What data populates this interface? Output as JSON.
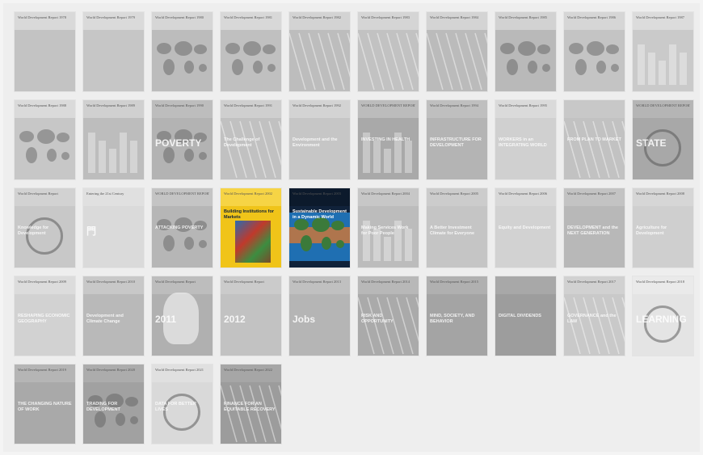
{
  "palette": {
    "page_bg": "#f4f4f4",
    "grid_bg": "#eeeeee",
    "muted_cover": "#c9c9c9",
    "accent_yellow": "#f0c419",
    "accent_dark": "#10223a"
  },
  "covers": [
    {
      "title": "World Development Report 1978",
      "big": "",
      "bg": "#c3c3c3",
      "top": "#d9d9d9",
      "style": "plain"
    },
    {
      "title": "World Development Report 1979",
      "big": "",
      "bg": "#c6c6c6",
      "top": "#dadada",
      "style": "plain"
    },
    {
      "title": "World Development Report 1980",
      "big": "",
      "bg": "#bcbcbc",
      "top": "#d6d6d6",
      "style": "map"
    },
    {
      "title": "World Development Report 1981",
      "big": "",
      "bg": "#c0c0c0",
      "top": "#d8d8d8",
      "style": "map"
    },
    {
      "title": "World Development Report 1982",
      "big": "",
      "bg": "#bdbdbd",
      "top": "#d3d3d3",
      "style": "lines"
    },
    {
      "title": "World Development Report 1983",
      "big": "",
      "bg": "#c2c2c2",
      "top": "#d5d5d5",
      "style": "lines"
    },
    {
      "title": "World Development Report 1984",
      "big": "",
      "bg": "#bbbbbb",
      "top": "#d4d4d4",
      "style": "lines"
    },
    {
      "title": "World Development Report 1985",
      "big": "",
      "bg": "#b9b9b9",
      "top": "#d2d2d2",
      "style": "map"
    },
    {
      "title": "World Development Report 1986",
      "big": "",
      "bg": "#c4c4c4",
      "top": "#d6d6d6",
      "style": "map"
    },
    {
      "title": "World Development Report 1987",
      "big": "",
      "bg": "#cacaca",
      "top": "#dcdcdc",
      "style": "bars"
    },
    {
      "title": "World Development Report 1988",
      "big": "",
      "bg": "#c7c7c7",
      "top": "#dadada",
      "style": "map"
    },
    {
      "title": "World Development Report 1989",
      "big": "",
      "bg": "#bdbdbd",
      "top": "#d0d0d0",
      "style": "bars"
    },
    {
      "title": "World Development Report 1990",
      "big": "POVERTY",
      "bg": "#b3b3b3",
      "top": "#bdbdbd",
      "style": "map"
    },
    {
      "title": "World Development Report 1991",
      "big": "The Challenge of Development",
      "bg": "#c1c1c1",
      "top": "#cfcfcf",
      "style": "lines"
    },
    {
      "title": "World Development Report 1992",
      "big": "Development and the Environment",
      "bg": "#c6c6c6",
      "top": "#d3d3d3",
      "style": "plain"
    },
    {
      "title": "WORLD DEVELOPMENT REPORT 1993",
      "big": "INVESTING IN HEALTH",
      "bg": "#a9a9a9",
      "top": "#bcbcbc",
      "style": "bars"
    },
    {
      "title": "World Development Report 1994",
      "big": "INFRASTRUCTURE FOR DEVELOPMENT",
      "bg": "#b4b4b4",
      "top": "#bfbfbf",
      "style": "plain"
    },
    {
      "title": "World Development Report 1995",
      "big": "WORKERS in an INTEGRATING WORLD",
      "bg": "#d0d0d0",
      "top": "#dadada",
      "style": "plain"
    },
    {
      "title": "",
      "big": "FROM PLAN TO MARKET",
      "bg": "#c2c2c2",
      "top": "#c8c8c8",
      "style": "lines"
    },
    {
      "title": "WORLD DEVELOPMENT REPORT 1997",
      "big": "STATE",
      "bg": "#a8a8a8",
      "top": "#b5b5b5",
      "style": "globe"
    },
    {
      "title": "World Development Report",
      "big": "Knowledge for Development",
      "bg": "#c8c8c8",
      "top": "#d2d2d2",
      "style": "globe"
    },
    {
      "title": "Entering the 21st Century",
      "big": "門",
      "bg": "#dadada",
      "top": "#e0e0e0",
      "style": "plain"
    },
    {
      "title": "WORLD DEVELOPMENT REPORT",
      "big": "ATTACKING POVERTY",
      "bg": "#b6b6b6",
      "top": "#c4c4c4",
      "style": "map"
    },
    {
      "title": "World Development Report 2002",
      "big": "Building Institutions for Markets",
      "bg": "#f0c419",
      "top": "#f6d445",
      "style": "color"
    },
    {
      "title": "World Development Report 2003",
      "big": "Sustainable Development in a Dynamic World",
      "bg": "#10223a",
      "top": "#0c1a2c",
      "style": "earth"
    },
    {
      "title": "World Development Report 2004",
      "big": "Making Services Work for Poor People",
      "bg": "#bcbcbc",
      "top": "#c7c7c7",
      "style": "bars"
    },
    {
      "title": "World Development Report 2005",
      "big": "A Better Investment Climate for Everyone",
      "bg": "#c5c5c5",
      "top": "#cccccc",
      "style": "plain"
    },
    {
      "title": "World Development Report 2006",
      "big": "Equity and Development",
      "bg": "#d2d2d2",
      "top": "#d8d8d8",
      "style": "plain"
    },
    {
      "title": "World Development Report 2007",
      "big": "DEVELOPMENT and the NEXT GENERATION",
      "bg": "#b8b8b8",
      "top": "#c3c3c3",
      "style": "plain"
    },
    {
      "title": "World Development Report 2008",
      "big": "Agriculture for Development",
      "bg": "#cfcfcf",
      "top": "#d6d6d6",
      "style": "plain"
    },
    {
      "title": "World Development Report 2009",
      "big": "RESHAPING ECONOMIC GEOGRAPHY",
      "bg": "#d2d2d2",
      "top": "#dcdcdc",
      "style": "plain"
    },
    {
      "title": "World Development Report 2010",
      "big": "Development and Climate Change",
      "bg": "#b9b9b9",
      "top": "#c8c8c8",
      "style": "plain"
    },
    {
      "title": "World Development Report",
      "big": "2011",
      "bg": "#b0b0b0",
      "top": "#bdbdbd",
      "style": "hand"
    },
    {
      "title": "World Development Report",
      "big": "2012",
      "bg": "#c2c2c2",
      "top": "#cbcbcb",
      "style": "plain"
    },
    {
      "title": "World Development Report 2013",
      "big": "Jobs",
      "bg": "#b5b5b5",
      "top": "#c0c0c0",
      "style": "plain"
    },
    {
      "title": "World Development Report 2014",
      "big": "RISK AND OPPORTUNITY",
      "bg": "#aaaaaa",
      "top": "#b8b8b8",
      "style": "lines"
    },
    {
      "title": "World Development Report 2015",
      "big": "MIND, SOCIETY, AND BEHAVIOR",
      "bg": "#a4a4a4",
      "top": "#b0b0b0",
      "style": "plain"
    },
    {
      "title": "",
      "big": "DIGITAL DIVIDENDS",
      "bg": "#9d9d9d",
      "top": "#a8a8a8",
      "style": "plain"
    },
    {
      "title": "World Development Report 2017",
      "big": "GOVERNANCE and the LAW",
      "bg": "#c9c9c9",
      "top": "#d1d1d1",
      "style": "lines"
    },
    {
      "title": "World Development Report 2018",
      "big": "LEARNING",
      "bg": "#e4e4e4",
      "top": "#eaeaea",
      "style": "globe"
    },
    {
      "title": "World Development Report 2019",
      "big": "THE CHANGING NATURE OF WORK",
      "bg": "#a9a9a9",
      "top": "#b5b5b5",
      "style": "plain"
    },
    {
      "title": "World Development Report 2020",
      "big": "TRADING FOR DEVELOPMENT",
      "bg": "#a1a1a1",
      "top": "#acacac",
      "style": "map"
    },
    {
      "title": "World Development Report 2021",
      "big": "DATA FOR BETTER LIVES",
      "bg": "#d9d9d9",
      "top": "#e0e0e0",
      "style": "globe"
    },
    {
      "title": "World Development Report 2022",
      "big": "FINANCE FOR AN EQUITABLE RECOVERY",
      "bg": "#9c9c9c",
      "top": "#a6a6a6",
      "style": "lines"
    }
  ]
}
